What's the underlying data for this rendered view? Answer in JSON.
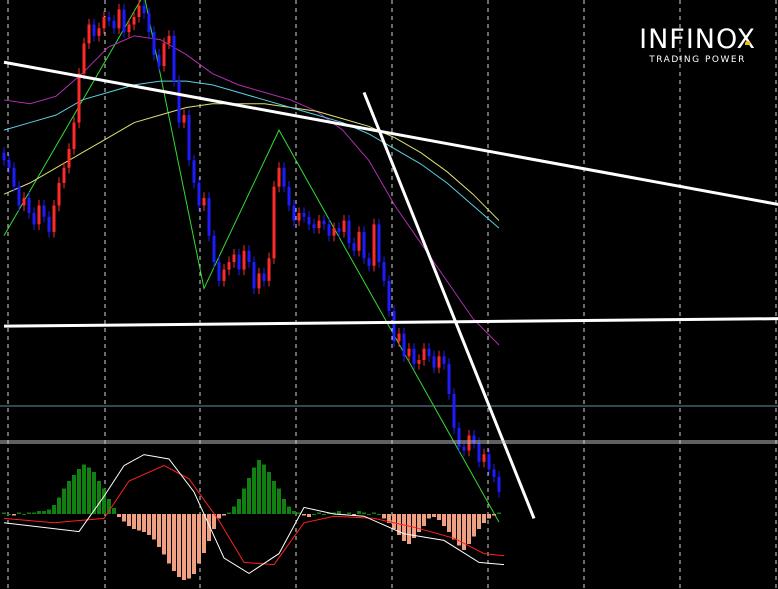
{
  "brand": {
    "name": "INFINOX",
    "tagline": "TRADING POWER"
  },
  "colors": {
    "background": "#000000",
    "bull_candle": "#ff2a2a",
    "bear_candle": "#1c1cff",
    "trendline": "#ffffff",
    "zigzag": "#33dd33",
    "ma_fast": "#5ad0e0",
    "ma_mid": "#e0e070",
    "ma_slow": "#b030b0",
    "hist_pos": "#108010",
    "hist_neg": "#f0a080",
    "macd_line": "#ffffff",
    "signal_line": "#ff2020",
    "grid": "#ffffff",
    "brand_accent": "#f2c200"
  },
  "chart_data": {
    "type": "candlestick",
    "grid": true,
    "price_panel": {
      "close": [
        0.62,
        0.6,
        0.55,
        0.5,
        0.52,
        0.48,
        0.45,
        0.5,
        0.47,
        0.43,
        0.5,
        0.56,
        0.6,
        0.65,
        0.72,
        0.85,
        0.93,
        0.98,
        0.95,
        0.97,
        1.0,
        0.99,
        0.97,
        1.02,
        0.96,
        0.98,
        1.0,
        1.03,
        1.01,
        0.96,
        0.9,
        0.87,
        0.93,
        0.95,
        0.83,
        0.72,
        0.74,
        0.62,
        0.56,
        0.5,
        0.52,
        0.42,
        0.35,
        0.3,
        0.33,
        0.35,
        0.37,
        0.33,
        0.38,
        0.35,
        0.28,
        0.32,
        0.3,
        0.36,
        0.55,
        0.6,
        0.55,
        0.5,
        0.46,
        0.48,
        0.47,
        0.45,
        0.44,
        0.46,
        0.45,
        0.42,
        0.44,
        0.43,
        0.46,
        0.4,
        0.38,
        0.43,
        0.36,
        0.34,
        0.45,
        0.35,
        0.3,
        0.22,
        0.14,
        0.16,
        0.1,
        0.12,
        0.08,
        0.09,
        0.12,
        0.1,
        0.07,
        0.1,
        0.08,
        0.0,
        -0.09,
        -0.14,
        -0.15,
        -0.11,
        -0.13,
        -0.18,
        -0.16,
        -0.2,
        -0.22,
        -0.26
      ],
      "ma_fast": [
        0.7,
        0.72,
        0.74,
        0.78,
        0.8,
        0.82,
        0.83,
        0.83,
        0.82,
        0.8,
        0.78,
        0.76,
        0.74,
        0.72,
        0.69,
        0.65,
        0.61,
        0.56,
        0.5,
        0.44
      ],
      "ma_mid": [
        0.53,
        0.56,
        0.6,
        0.64,
        0.68,
        0.72,
        0.74,
        0.76,
        0.77,
        0.77,
        0.77,
        0.76,
        0.75,
        0.73,
        0.71,
        0.68,
        0.64,
        0.59,
        0.53,
        0.46
      ],
      "ma_slow": [
        0.78,
        0.77,
        0.79,
        0.85,
        0.92,
        0.95,
        0.94,
        0.9,
        0.85,
        0.82,
        0.8,
        0.78,
        0.75,
        0.7,
        0.62,
        0.5,
        0.4,
        0.3,
        0.2,
        0.13
      ],
      "zigzag": [
        [
          0,
          0.42
        ],
        [
          28,
          1.06
        ],
        [
          40,
          0.28
        ],
        [
          55,
          0.7
        ],
        [
          99,
          -0.34
        ]
      ],
      "trendlines": [
        [
          [
            0,
            0.88
          ],
          [
            156,
            0.5
          ]
        ],
        [
          [
            0,
            0.18
          ],
          [
            156,
            0.2
          ]
        ],
        [
          [
            72,
            0.8
          ],
          [
            106,
            -0.33
          ]
        ]
      ]
    },
    "indicator_panel": {
      "histogram": [
        1,
        0,
        -1,
        1,
        0,
        1,
        1,
        2,
        2,
        3,
        6,
        11,
        17,
        22,
        26,
        30,
        33,
        31,
        28,
        22,
        17,
        10,
        4,
        -2,
        -5,
        -8,
        -10,
        -11,
        -12,
        -14,
        -17,
        -22,
        -27,
        -33,
        -38,
        -42,
        -44,
        -43,
        -40,
        -33,
        -26,
        -18,
        -10,
        -3,
        -1,
        1,
        5,
        10,
        17,
        24,
        31,
        36,
        33,
        28,
        22,
        17,
        10,
        5,
        2,
        1,
        -1,
        -2,
        0,
        1,
        0,
        1,
        1,
        2,
        0,
        1,
        -1,
        2,
        1,
        0,
        1,
        0,
        -3,
        -6,
        -10,
        -14,
        -18,
        -20,
        -16,
        -12,
        -8,
        -3,
        -2,
        -4,
        -8,
        -12,
        -17,
        -21,
        -24,
        -20,
        -15,
        -10,
        -6,
        -3,
        -1,
        1
      ],
      "macd": [
        [
          0,
          -4
        ],
        [
          15,
          -8
        ],
        [
          20,
          8
        ],
        [
          24,
          22
        ],
        [
          28,
          27
        ],
        [
          33,
          25
        ],
        [
          38,
          10
        ],
        [
          44,
          -20
        ],
        [
          49,
          -27
        ],
        [
          55,
          -18
        ],
        [
          60,
          3
        ],
        [
          66,
          0
        ],
        [
          72,
          -1
        ],
        [
          80,
          -9
        ],
        [
          88,
          -12
        ],
        [
          95,
          -22
        ],
        [
          100,
          -23
        ]
      ],
      "signal": [
        [
          0,
          -2
        ],
        [
          10,
          -4
        ],
        [
          20,
          -2
        ],
        [
          25,
          15
        ],
        [
          32,
          22
        ],
        [
          37,
          16
        ],
        [
          43,
          -3
        ],
        [
          48,
          -22
        ],
        [
          54,
          -23
        ],
        [
          60,
          -4
        ],
        [
          66,
          -1
        ],
        [
          74,
          -2
        ],
        [
          82,
          -6
        ],
        [
          90,
          -11
        ],
        [
          96,
          -18
        ],
        [
          100,
          -19
        ]
      ]
    }
  }
}
